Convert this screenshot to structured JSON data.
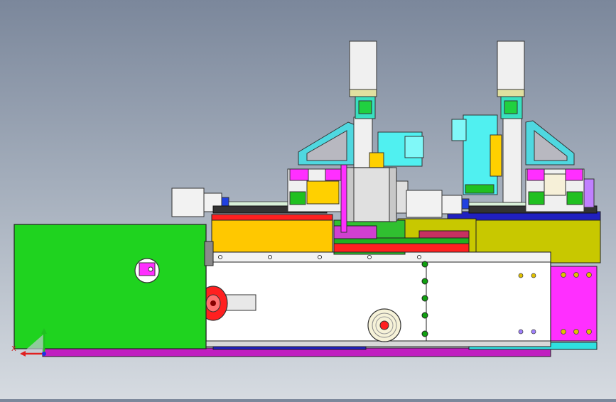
{
  "viewport": {
    "background_top": "#7b879b",
    "background_bottom": "#d6dbe1"
  },
  "triad": {
    "x_label": "X",
    "x_color": "#e02020",
    "y_color": "#20c020",
    "z_color": "#2030e0"
  },
  "colors": {
    "green_cover": "#1fd31f",
    "base_rail": "#c01fc0",
    "white_frame": "#ffffff",
    "yellow_plate": "#ffc800",
    "olive_plate": "#c8c800",
    "magenta_block": "#ff2fff",
    "cyan_bracket": "#4fd8e0",
    "motor_white": "#f2f2f2",
    "drum_gray": "#e0e0e0",
    "blue_bar": "#2020c0",
    "red_strip": "#ff2020"
  }
}
